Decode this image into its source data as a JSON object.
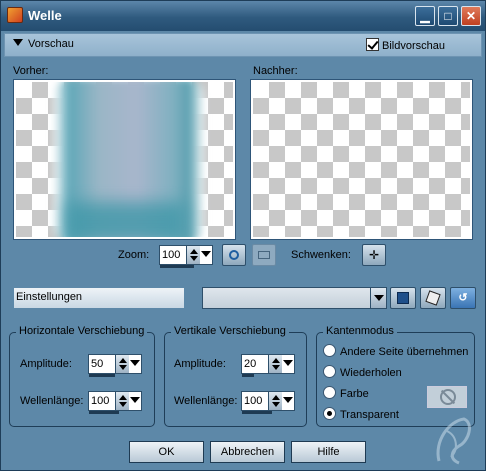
{
  "window": {
    "title": "Welle"
  },
  "preview": {
    "toggle_label": "Vorschau",
    "checkbox_label": "Bildvorschau",
    "before_label": "Vorher:",
    "after_label": "Nachher:",
    "zoom_label": "Zoom:",
    "zoom_value": "100",
    "pan_label": "Schwenken:"
  },
  "settings": {
    "label": "Einstellungen",
    "preset_value": ""
  },
  "horizontal": {
    "title": "Horizontale Verschiebung",
    "amplitude_label": "Amplitude:",
    "amplitude_value": "50",
    "wavelength_label": "Wellenlänge:",
    "wavelength_value": "100"
  },
  "vertical": {
    "title": "Vertikale Verschiebung",
    "amplitude_label": "Amplitude:",
    "amplitude_value": "20",
    "wavelength_label": "Wellenlänge:",
    "wavelength_value": "100"
  },
  "edge_mode": {
    "title": "Kantenmodus",
    "options": [
      "Andere Seite übernehmen",
      "Wiederholen",
      "Farbe",
      "Transparent"
    ],
    "selected": "Transparent"
  },
  "buttons": {
    "ok": "OK",
    "cancel": "Abbrechen",
    "help": "Hilfe"
  },
  "colors": {
    "window_bg": "#5d88a8",
    "titlebar": "#2f5a7e",
    "panel_bar": "#a8c4da"
  }
}
